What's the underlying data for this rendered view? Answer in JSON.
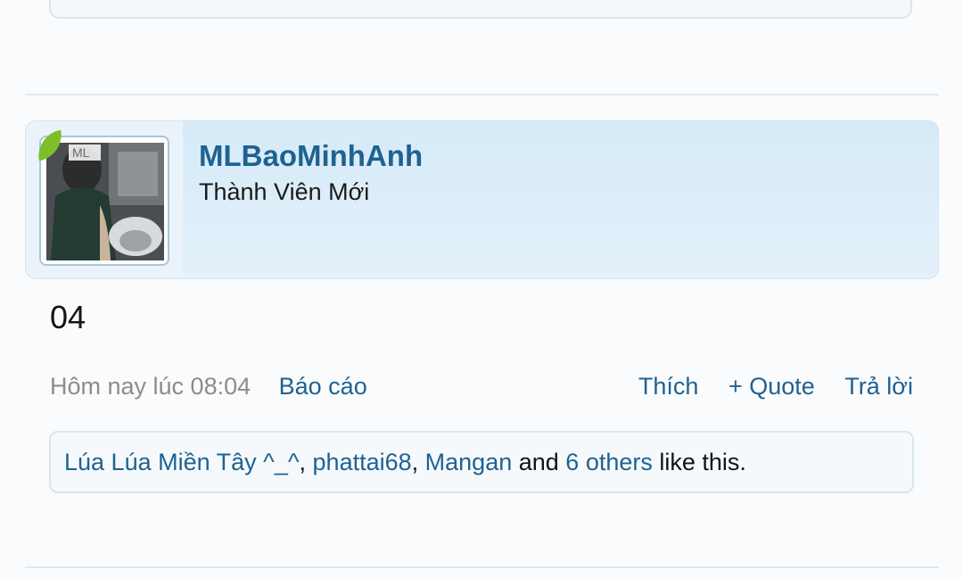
{
  "post": {
    "username": "MLBaoMinhAnh",
    "user_title": "Thành Viên Mới",
    "avatar_text": "ML",
    "message": "04",
    "timestamp": "Hôm nay lúc 08:04",
    "report_label": "Báo cáo",
    "like_label": "Thích",
    "quote_label": "+ Quote",
    "reply_label": "Trả lời"
  },
  "likes": {
    "users": [
      "Lúa Lúa Miền Tây ^_^",
      "phattai68",
      "Mangan"
    ],
    "sep1": ", ",
    "sep2": ", ",
    "and": " and ",
    "others": "6 others",
    "suffix": " like this."
  },
  "colors": {
    "link": "#1f6291",
    "username": "#1d5f8f",
    "header_bg": "#d6eaf8",
    "leaf": "#7cbf2a"
  }
}
